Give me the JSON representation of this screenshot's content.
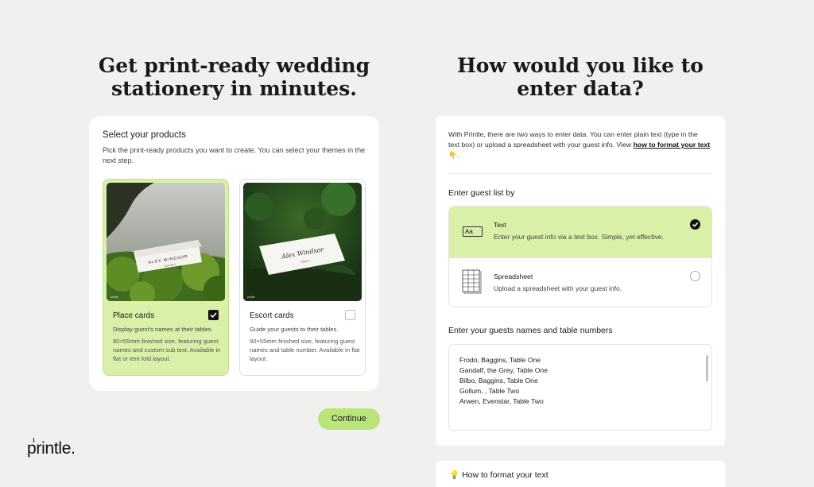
{
  "left": {
    "heading": "Get print-ready wedding stationery in minutes.",
    "products_title": "Select your products",
    "products_subtitle": "Pick the print-ready products you want to create. You can select your themes in the next step.",
    "products": [
      {
        "name": "Place cards",
        "selected": true,
        "description": "Display guest’s names at their tables.",
        "spec": "90×55mm finished size, featuring guest names and custom sub text. Available in flat or tent fold layout.",
        "card_name": "ALEX WINDSOR",
        "card_sub": "SUB TEXT",
        "brand": "printle"
      },
      {
        "name": "Escort cards",
        "selected": false,
        "description": "Guide your guests to their tables.",
        "spec": "90×55mm finished size, featuring guest names and table number. Available in flat layout.",
        "card_name": "Alex Windsor",
        "card_sub": "TABLE 1",
        "brand": "printle"
      }
    ],
    "continue_label": "Continue",
    "logo": "printle."
  },
  "right": {
    "heading": "How would you like to enter data?",
    "intro_text": "With Printle, there are two ways to enter data. You can enter plain text (type in the text box) or upload a spreadsheet with your guest info. View ",
    "intro_link": "how to format your text",
    "intro_emoji": "👇",
    "intro_end": ".",
    "guest_list_by_title": "Enter guest list by",
    "options": [
      {
        "title": "Text",
        "description": "Enter your guest info via a text box. Simple, yet effective.",
        "icon": "Aa",
        "selected": true
      },
      {
        "title": "Spreadsheet",
        "description": "Upload a spreadsheet with your guest info.",
        "icon": "spreadsheet-icon",
        "selected": false
      }
    ],
    "guests_title": "Enter your guests names and table numbers",
    "guests": [
      "Frodo, Baggins, Table One",
      "Gandalf, the Grey, Table One",
      "Bilbo, Baggins, Table One",
      "Gollum, , Table Two",
      "Arwen, Evenstar, Table Two"
    ],
    "howto_title": "How to format your text",
    "howto_icon": "💡"
  },
  "colors": {
    "accent": "#b9e47a",
    "selected_bg": "#d8f0a8",
    "page_bg": "#f1f0ee"
  }
}
